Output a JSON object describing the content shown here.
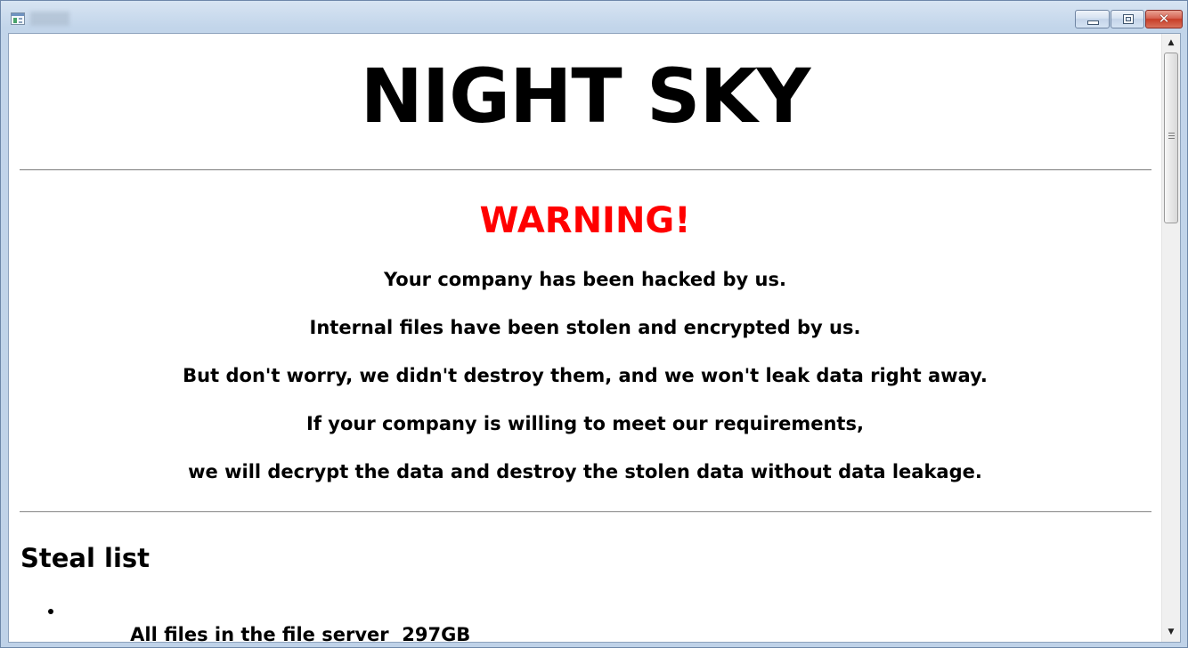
{
  "window": {
    "title": "",
    "close_symbol": "✕"
  },
  "icons": {
    "app": "application-icon",
    "minimize": "minimize-icon",
    "maximize": "maximize-icon",
    "close": "close-icon",
    "scroll_up": "arrow-up-icon",
    "scroll_down": "arrow-down-icon"
  },
  "page": {
    "title": "NIGHT SKY",
    "warning": "WARNING!",
    "warning_color": "#ff0000",
    "messages": [
      "Your company has been hacked by us.",
      "Internal files have been stolen and encrypted by us.",
      "But don't worry, we didn't destroy them, and we won't leak data right away.",
      "If your company is willing to meet our requirements,",
      "we will decrypt the data and destroy the stolen data without data leakage."
    ],
    "steal_list": {
      "heading": "Steal list",
      "items": [
        "All files in the file server  297GB"
      ]
    }
  },
  "scrollbar": {
    "up_symbol": "▲",
    "down_symbol": "▼"
  }
}
